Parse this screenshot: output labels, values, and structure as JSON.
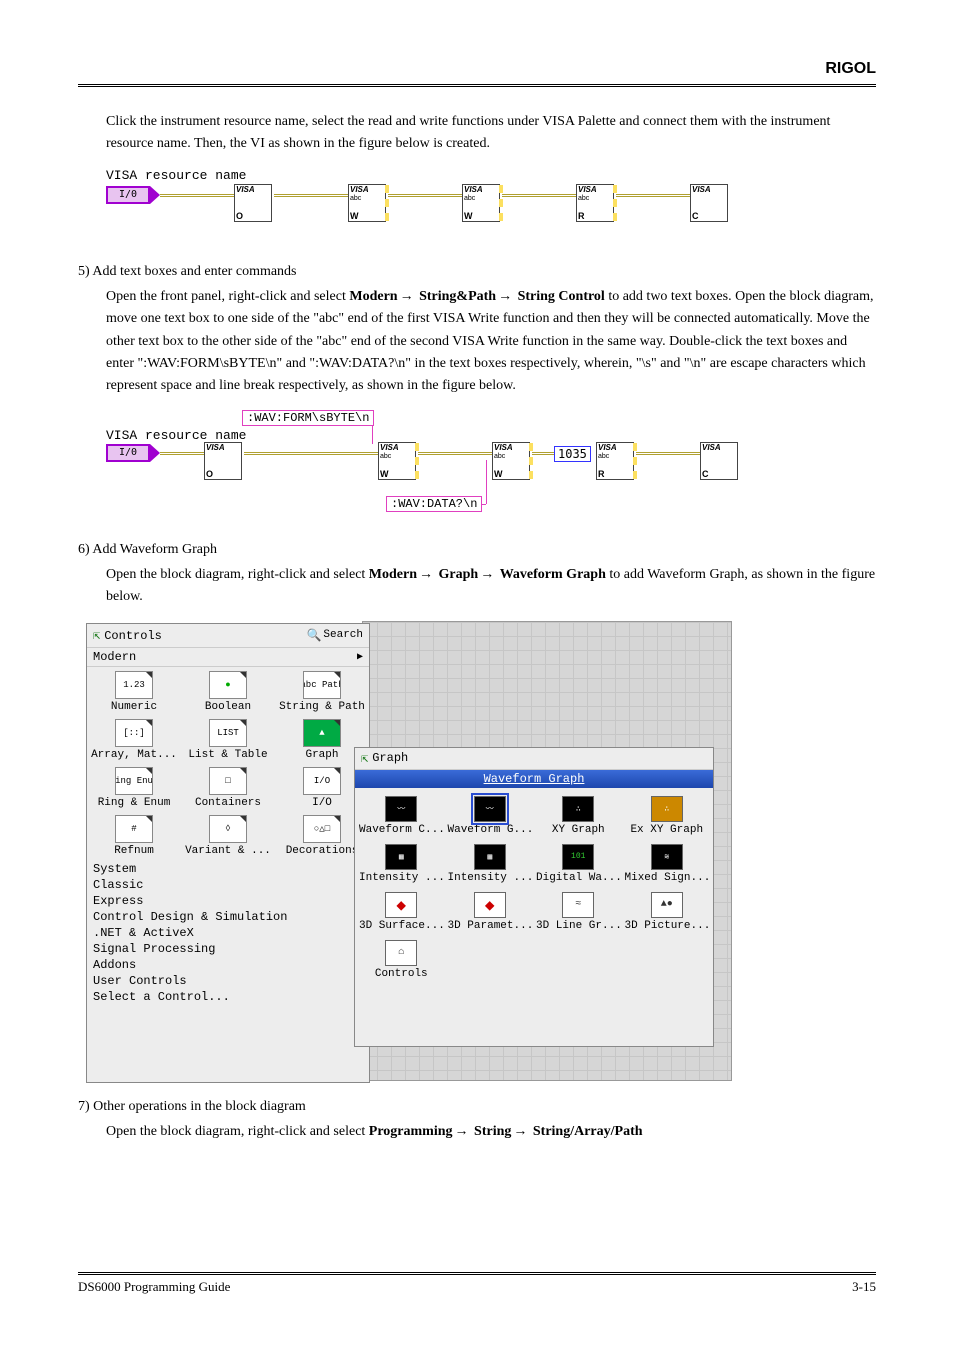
{
  "header": {
    "brand": "RIGOL"
  },
  "intro": "Click the instrument resource name, select the read and write functions under VISA Palette and connect them with the instrument resource name. Then, the VI as shown in the figure below is created.",
  "diag1": {
    "title": "VISA resource name",
    "ionode": "I/0",
    "visa_nodes": [
      {
        "v": "VISA",
        "s1": "",
        "s2": "O"
      },
      {
        "v": "VISA",
        "s1": "abc",
        "s2": "W"
      },
      {
        "v": "VISA",
        "s1": "abc",
        "s2": "W"
      },
      {
        "v": "VISA",
        "s1": "abc",
        "s2": "R"
      },
      {
        "v": "VISA",
        "s1": "",
        "s2": "C"
      }
    ]
  },
  "step5": {
    "label": "5) Add text boxes and enter commands",
    "text_a": "Open the front panel, right-click and select ",
    "path": "Modern",
    "path2": "String&Path",
    "path3": "String Control",
    "text_b": " to add two text boxes. Open the block diagram, move one text box to one side of the \"abc\" end of the first VISA Write function and then they will be connected automatically. Move the other text box to the other side of the \"abc\" end of the second VISA Write function in the same way. Double-click the text boxes and enter \":WAV:FORM\\sBYTE\\n\" and \":WAV:DATA?\\n\" in the text boxes respectively, wherein, \"\\s\" and \"\\n\" are escape characters which represent space and line break respectively, as shown in the figure below."
  },
  "diag2": {
    "title": "VISA resource name",
    "ionode": "I/0",
    "cmd1": ":WAV:FORM\\sBYTE\\n",
    "cmd2": ":WAV:DATA?\\n",
    "const": "1035",
    "visa_nodes": [
      {
        "v": "VISA",
        "s1": "",
        "s2": "O"
      },
      {
        "v": "VISA",
        "s1": "abc",
        "s2": "W"
      },
      {
        "v": "VISA",
        "s1": "abc",
        "s2": "W"
      },
      {
        "v": "VISA",
        "s1": "abc",
        "s2": "R"
      },
      {
        "v": "VISA",
        "s1": "",
        "s2": "C"
      }
    ]
  },
  "step6": {
    "label": "6) Add Waveform Graph",
    "text_a": "Open the block diagram, right-click and select ",
    "p1": "Modern",
    "p2": "Graph",
    "p3": "Waveform Graph",
    "text_b": " to add Waveform Graph, as shown in the figure below."
  },
  "controls_palette": {
    "title": "Controls",
    "search": "Search",
    "section": "Modern",
    "items": [
      {
        "label": "Numeric",
        "icon": "1.23"
      },
      {
        "label": "Boolean",
        "icon": "●"
      },
      {
        "label": "String & Path",
        "icon": "abc Path"
      },
      {
        "label": "Array, Mat...",
        "icon": "[::]"
      },
      {
        "label": "List & Table",
        "icon": "LIST"
      },
      {
        "label": "Graph",
        "icon": "▲"
      },
      {
        "label": "Ring & Enum",
        "icon": "Ring Enum"
      },
      {
        "label": "Containers",
        "icon": "□"
      },
      {
        "label": "I/O",
        "icon": "I/O"
      },
      {
        "label": "Refnum",
        "icon": "#"
      },
      {
        "label": "Variant & ...",
        "icon": "◊"
      },
      {
        "label": "Decorations",
        "icon": "○△□"
      }
    ],
    "categories": [
      "System",
      "Classic",
      "Express",
      "Control Design & Simulation",
      ".NET & ActiveX",
      "Signal Processing",
      "Addons",
      "User Controls",
      "Select a Control..."
    ]
  },
  "graph_palette": {
    "title": "Graph",
    "selected": "Waveform Graph",
    "items": [
      "Waveform C...",
      "Waveform G...",
      "XY Graph",
      "Ex XY Graph",
      "Intensity ...",
      "Intensity ...",
      "Digital Wa...",
      "Mixed Sign...",
      "3D Surface...",
      "3D Paramet...",
      "3D Line Gr...",
      "3D Picture...",
      "Controls"
    ]
  },
  "step7": {
    "label": "7) Other operations in the block diagram",
    "text_a": "Open the block diagram, right-click and select ",
    "p1": "Programming",
    "p2": "String",
    "p3": "String/Array/Path"
  },
  "footer": {
    "left": "DS6000 Programming Guide",
    "right": "3-15"
  }
}
